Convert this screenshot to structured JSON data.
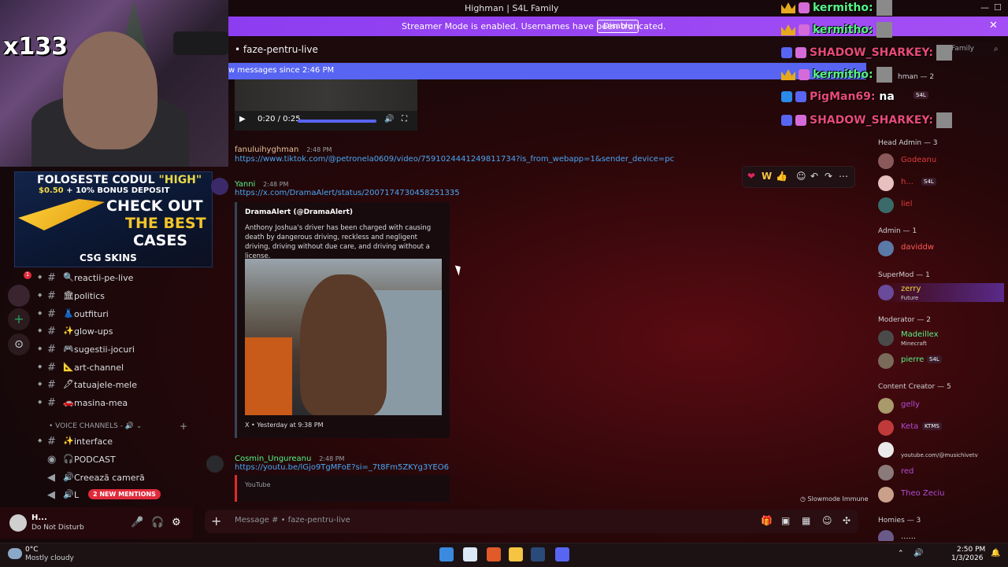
{
  "window": {
    "title": "Highman | S4L Family"
  },
  "banner": {
    "message": "Streamer Mode is enabled. Usernames have been truncated.",
    "button": "Disable"
  },
  "channel": {
    "name": "faze-pentru-live",
    "new_messages": "w messages since 2:46 PM"
  },
  "webcam": {
    "counter": "x133"
  },
  "ad": {
    "line1_pre": "FOLOSESTE CODUL ",
    "line1_code": "\"HIGH\"",
    "line2_amount": "$0.50",
    "line2_rest": " + 10% BONUS DEPOSIT",
    "check": "CHECK OUT",
    "best": "THE BEST",
    "cases": "CASES",
    "brand": "CSG SKINS"
  },
  "channels": [
    {
      "emoji": "🔍",
      "name": "reactii-pe-live"
    },
    {
      "emoji": "🏛",
      "name": "politics"
    },
    {
      "emoji": "👗",
      "name": "outfituri"
    },
    {
      "emoji": "✨",
      "name": "glow-ups"
    },
    {
      "emoji": "🎮",
      "name": "sugestii-jocuri"
    },
    {
      "emoji": "📐",
      "name": "art-channel"
    },
    {
      "emoji": "🖋",
      "name": "tatuajele-mele"
    },
    {
      "emoji": "🚗",
      "name": "masina-mea"
    }
  ],
  "voice": {
    "header": "VOICE CHANNELS",
    "items": [
      {
        "emoji": "✨",
        "name": "interface"
      },
      {
        "emoji": "🎧",
        "name": "PODCAST"
      },
      {
        "emoji": "🔊",
        "name": "Creează cameră"
      },
      {
        "emoji": "🔊",
        "name": "L"
      }
    ]
  },
  "mentions": "2 NEW MENTIONS",
  "user": {
    "name": "H...",
    "status": "Do Not Disturb"
  },
  "video": {
    "time": "0:20 / 0:25"
  },
  "messages": [
    {
      "author": "fanuluihyghman",
      "time": "2:48 PM",
      "link": "https://www.tiktok.com/@petronela0609/video/7591024441249811734?is_from_webapp=1&sender_device=pc",
      "color": "#e8c39a"
    },
    {
      "author": "Yanni",
      "time": "2:48 PM",
      "link": "https://x.com/DramaAlert/status/2007174730458251335",
      "color": "#57f287"
    },
    {
      "author": "Cosmin_Ungureanu",
      "time": "2:48 PM",
      "link": "https://youtu.be/lGjo9TgMFoE?si=_7t8Fm5ZKYg3YEO6",
      "color": "#57f287"
    }
  ],
  "embed": {
    "author": "DramaAlert (@DramaAlert)",
    "description": "Anthony Joshua's driver has been charged with causing death by dangerous driving, reckless and negligent driving, driving without due care, and driving without a license.",
    "footer": "X • Yesterday at 9:38 PM"
  },
  "yt_embed": {
    "label": "YouTube"
  },
  "slowmode": "Slowmode Immune",
  "composer": {
    "placeholder": "Message #   • faze-pentru-live"
  },
  "reactions": [
    "❤",
    "W",
    "👍"
  ],
  "search": {
    "placeholder": "Family"
  },
  "overlay_chat": [
    {
      "user": "kermitho:",
      "color": "#57f287"
    },
    {
      "user": "kermitho:",
      "color": "#57f287"
    },
    {
      "user": "SHADOW_SHARKEY:",
      "color": "#e94a78"
    },
    {
      "user": "kermitho:",
      "color": "#57f287"
    },
    {
      "user": "PigMan69:",
      "color": "#e94a78",
      "text": "na"
    },
    {
      "user": "SHADOW_SHARKEY:",
      "color": "#e94a78"
    }
  ],
  "members": {
    "groups": [
      {
        "label": "hman — 2"
      },
      {
        "label": "Head Admin — 3"
      },
      {
        "label": "Admin — 1"
      },
      {
        "label": "SuperMod — 1"
      },
      {
        "label": "Moderator — 2"
      },
      {
        "label": "Content Creator — 5"
      },
      {
        "label": "Homies — 3"
      }
    ],
    "rows": [
      {
        "name": "Godeanu",
        "color": "#e03a3a"
      },
      {
        "name": "h...",
        "color": "#e03a3a",
        "tag": "S4L"
      },
      {
        "name": "liel",
        "color": "#e03a3a"
      },
      {
        "name": "daviddw",
        "color": "#ff5a5a"
      },
      {
        "name": "zerry",
        "color": "#f5d742",
        "sub": "Future"
      },
      {
        "name": "Madeillex",
        "color": "#57f287",
        "sub": "Minecraft"
      },
      {
        "name": "pierre",
        "color": "#57f287",
        "tag": "S4L"
      },
      {
        "name": "gelly",
        "color": "#b24cd6"
      },
      {
        "name": "Keta",
        "color": "#b24cd6",
        "tag": "KTMS"
      },
      {
        "name": "",
        "color": "#b24cd6",
        "sub": "youtube.com/@musichivetv"
      },
      {
        "name": "red",
        "color": "#b24cd6"
      },
      {
        "name": "Theo Zeciu",
        "color": "#b24cd6"
      },
      {
        "name": "......",
        "color": "#cfd2d6"
      }
    ],
    "top_tag": "S4L"
  },
  "taskbar": {
    "temp": "0°C",
    "weather": "Mostly cloudy",
    "time": "2:50 PM",
    "date": "1/3/2026"
  }
}
